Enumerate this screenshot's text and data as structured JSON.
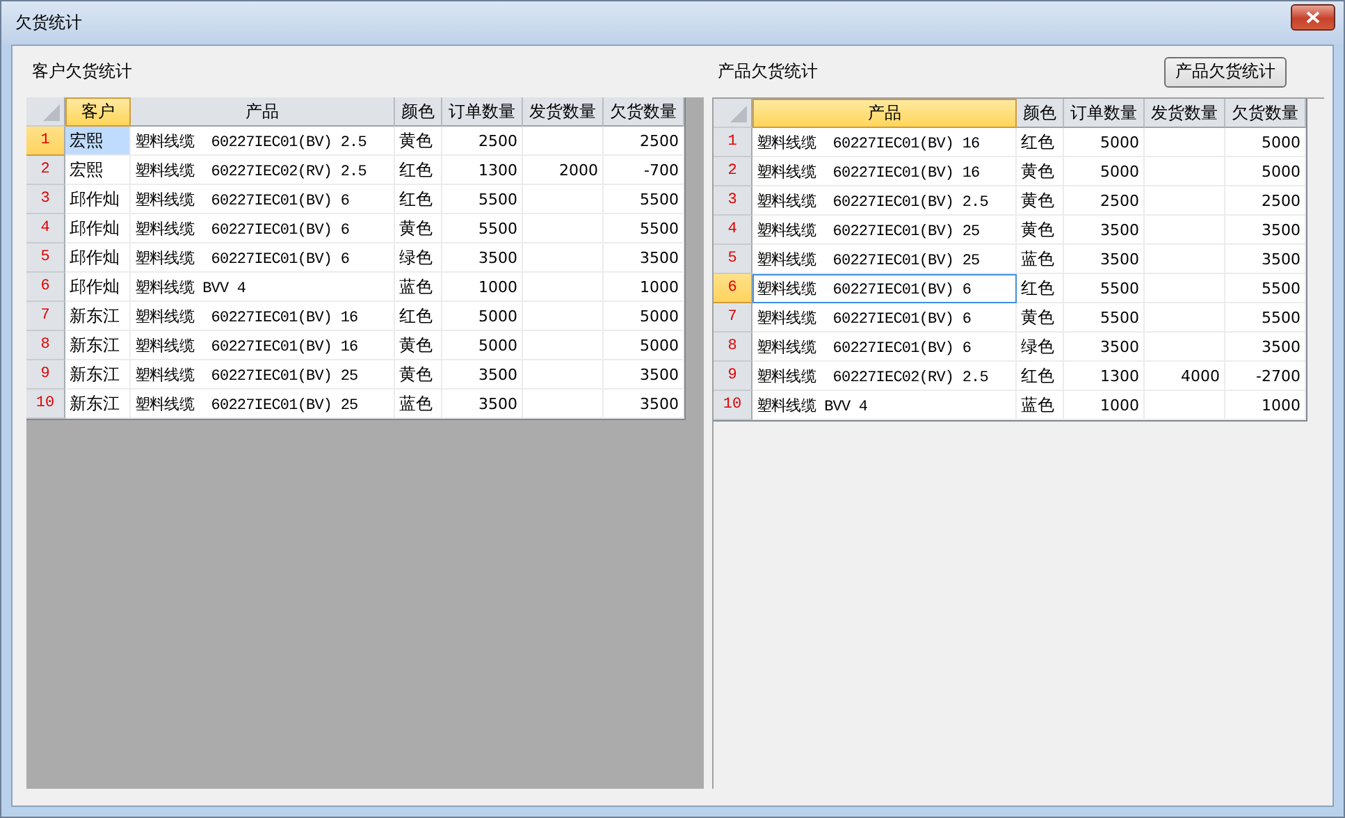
{
  "window": {
    "title": "欠货统计"
  },
  "tables": [
    {
      "title": "客户欠货统计",
      "kind": "master",
      "columns": [
        {
          "label": "客户",
          "kind": "text",
          "selected": true
        },
        {
          "label": "产品",
          "kind": "product",
          "selected": false
        },
        {
          "label": "颜色",
          "kind": "text",
          "selected": false
        },
        {
          "label": "订单数量",
          "kind": "number",
          "selected": false
        },
        {
          "label": "发货数量",
          "kind": "number",
          "selected": false
        },
        {
          "label": "欠货数量",
          "kind": "number",
          "selected": false
        }
      ],
      "rows": [
        {
          "number": "1",
          "selected": true,
          "cells": [
            "宏熙",
            "塑料线缆  60227IEC01(BV) 2.5",
            "黄色",
            "2500",
            "",
            "2500"
          ]
        },
        {
          "number": "2",
          "selected": false,
          "cells": [
            "宏熙",
            "塑料线缆  60227IEC02(RV) 2.5",
            "红色",
            "1300",
            "2000",
            "-700"
          ]
        },
        {
          "number": "3",
          "selected": false,
          "cells": [
            "邱作灿",
            "塑料线缆  60227IEC01(BV) 6",
            "红色",
            "5500",
            "",
            "5500"
          ]
        },
        {
          "number": "4",
          "selected": false,
          "cells": [
            "邱作灿",
            "塑料线缆  60227IEC01(BV) 6",
            "黄色",
            "5500",
            "",
            "5500"
          ]
        },
        {
          "number": "5",
          "selected": false,
          "cells": [
            "邱作灿",
            "塑料线缆  60227IEC01(BV) 6",
            "绿色",
            "3500",
            "",
            "3500"
          ]
        },
        {
          "number": "6",
          "selected": false,
          "cells": [
            "邱作灿",
            "塑料线缆 BVV 4",
            "蓝色",
            "1000",
            "",
            "1000"
          ]
        },
        {
          "number": "7",
          "selected": false,
          "cells": [
            "新东江",
            "塑料线缆  60227IEC01(BV) 16",
            "红色",
            "5000",
            "",
            "5000"
          ]
        },
        {
          "number": "8",
          "selected": false,
          "cells": [
            "新东江",
            "塑料线缆  60227IEC01(BV) 16",
            "黄色",
            "5000",
            "",
            "5000"
          ]
        },
        {
          "number": "9",
          "selected": false,
          "cells": [
            "新东江",
            "塑料线缆  60227IEC01(BV) 25",
            "黄色",
            "3500",
            "",
            "3500"
          ]
        },
        {
          "number": "10",
          "selected": false,
          "cells": [
            "新东江",
            "塑料线缆  60227IEC01(BV) 25",
            "蓝色",
            "3500",
            "",
            "3500"
          ]
        }
      ]
    },
    {
      "title": "产品欠货统计",
      "button": "产品欠货统计",
      "kind": "detail",
      "columns": [
        {
          "label": "产品",
          "kind": "product",
          "selected": true
        },
        {
          "label": "颜色",
          "kind": "text",
          "selected": false
        },
        {
          "label": "订单数量",
          "kind": "number",
          "selected": false
        },
        {
          "label": "发货数量",
          "kind": "number",
          "selected": false
        },
        {
          "label": "欠货数量",
          "kind": "number",
          "selected": false
        }
      ],
      "rows": [
        {
          "number": "1",
          "selected": false,
          "cells": [
            "塑料线缆  60227IEC01(BV) 16",
            "红色",
            "5000",
            "",
            "5000"
          ]
        },
        {
          "number": "2",
          "selected": false,
          "cells": [
            "塑料线缆  60227IEC01(BV) 16",
            "黄色",
            "5000",
            "",
            "5000"
          ]
        },
        {
          "number": "3",
          "selected": false,
          "cells": [
            "塑料线缆  60227IEC01(BV) 2.5",
            "黄色",
            "2500",
            "",
            "2500"
          ]
        },
        {
          "number": "4",
          "selected": false,
          "cells": [
            "塑料线缆  60227IEC01(BV) 25",
            "黄色",
            "3500",
            "",
            "3500"
          ]
        },
        {
          "number": "5",
          "selected": false,
          "cells": [
            "塑料线缆  60227IEC01(BV) 25",
            "蓝色",
            "3500",
            "",
            "3500"
          ]
        },
        {
          "number": "6",
          "selected": true,
          "cells": [
            "塑料线缆  60227IEC01(BV) 6",
            "红色",
            "5500",
            "",
            "5500"
          ]
        },
        {
          "number": "7",
          "selected": false,
          "cells": [
            "塑料线缆  60227IEC01(BV) 6",
            "黄色",
            "5500",
            "",
            "5500"
          ]
        },
        {
          "number": "8",
          "selected": false,
          "cells": [
            "塑料线缆  60227IEC01(BV) 6",
            "绿色",
            "3500",
            "",
            "3500"
          ]
        },
        {
          "number": "9",
          "selected": false,
          "cells": [
            "塑料线缆  60227IEC02(RV) 2.5",
            "红色",
            "1300",
            "4000",
            "-2700"
          ]
        },
        {
          "number": "10",
          "selected": false,
          "cells": [
            "塑料线缆 BVV 4",
            "蓝色",
            "1000",
            "",
            "1000"
          ]
        }
      ]
    }
  ]
}
